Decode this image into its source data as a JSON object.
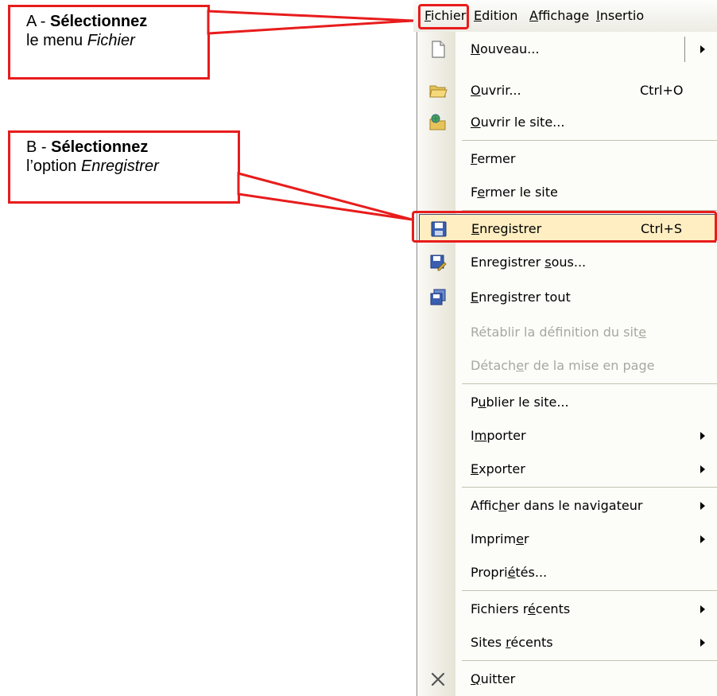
{
  "callouts": {
    "a": {
      "prefix": "A - ",
      "bold": "Sélectionnez",
      "line2_prefix": "le menu ",
      "line2_italic": "Fichier"
    },
    "b": {
      "prefix": "B - ",
      "bold": "Sélectionnez",
      "line2_prefix": "l’option ",
      "line2_italic": "Enregistrer"
    }
  },
  "menubar": {
    "fichier": {
      "u": "F",
      "rest": "ichier"
    },
    "edition": {
      "u": "E",
      "rest": "dition"
    },
    "affichage": {
      "u": "A",
      "rest": "ffichage"
    },
    "insertion": {
      "u": "I",
      "rest": "nsertio"
    }
  },
  "menu": {
    "nouveau": {
      "pre": "",
      "u": "N",
      "post": "ouveau..."
    },
    "ouvrir": {
      "pre": "",
      "u": "O",
      "post": "uvrir...",
      "shortcut": "Ctrl+O"
    },
    "ouvrir_site": {
      "pre": "",
      "u": "O",
      "post": "uvrir le site..."
    },
    "fermer": {
      "pre": "",
      "u": "F",
      "post": "ermer"
    },
    "fermer_site": {
      "pre": "F",
      "u": "e",
      "post": "rmer le site"
    },
    "enregistrer": {
      "pre": "",
      "u": "E",
      "post": "nregistrer",
      "shortcut": "Ctrl+S"
    },
    "enregistrer_sous": {
      "pre": "Enregistrer ",
      "u": "s",
      "post": "ous..."
    },
    "enregistrer_tout": {
      "pre": "",
      "u": "E",
      "post": "nregistrer tout"
    },
    "retablir": {
      "pre": "Rétablir la définition du sit",
      "u": "e",
      "post": ""
    },
    "detacher": {
      "pre": "Détach",
      "u": "e",
      "post": "r de la mise en page"
    },
    "publier": {
      "pre": "P",
      "u": "u",
      "post": "blier le site..."
    },
    "importer": {
      "pre": "I",
      "u": "m",
      "post": "porter"
    },
    "exporter": {
      "pre": "",
      "u": "E",
      "post": "xporter"
    },
    "afficher_nav": {
      "pre": "Affic",
      "u": "h",
      "post": "er dans le navigateur"
    },
    "imprimer": {
      "pre": "Imprim",
      "u": "e",
      "post": "r"
    },
    "proprietes": {
      "pre": "Propri",
      "u": "é",
      "post": "tés..."
    },
    "fichiers_recents": {
      "pre": "Fichiers r",
      "u": "é",
      "post": "cents"
    },
    "sites_recents": {
      "pre": "Sites ",
      "u": "r",
      "post": "écents"
    },
    "quitter": {
      "pre": "",
      "u": "Q",
      "post": "uitter"
    }
  },
  "icons": {
    "nouveau": "new-document-icon",
    "ouvrir": "open-folder-icon",
    "ouvrir_site": "open-site-icon",
    "enregistrer": "floppy-save-icon",
    "enregistrer_sous": "save-as-icon",
    "enregistrer_tout": "save-all-icon",
    "quitter": "close-x-icon"
  },
  "colors": {
    "callout_border": "#e81c1c",
    "highlight": "#ffeec2",
    "disabled_text": "#a8a8a0"
  }
}
